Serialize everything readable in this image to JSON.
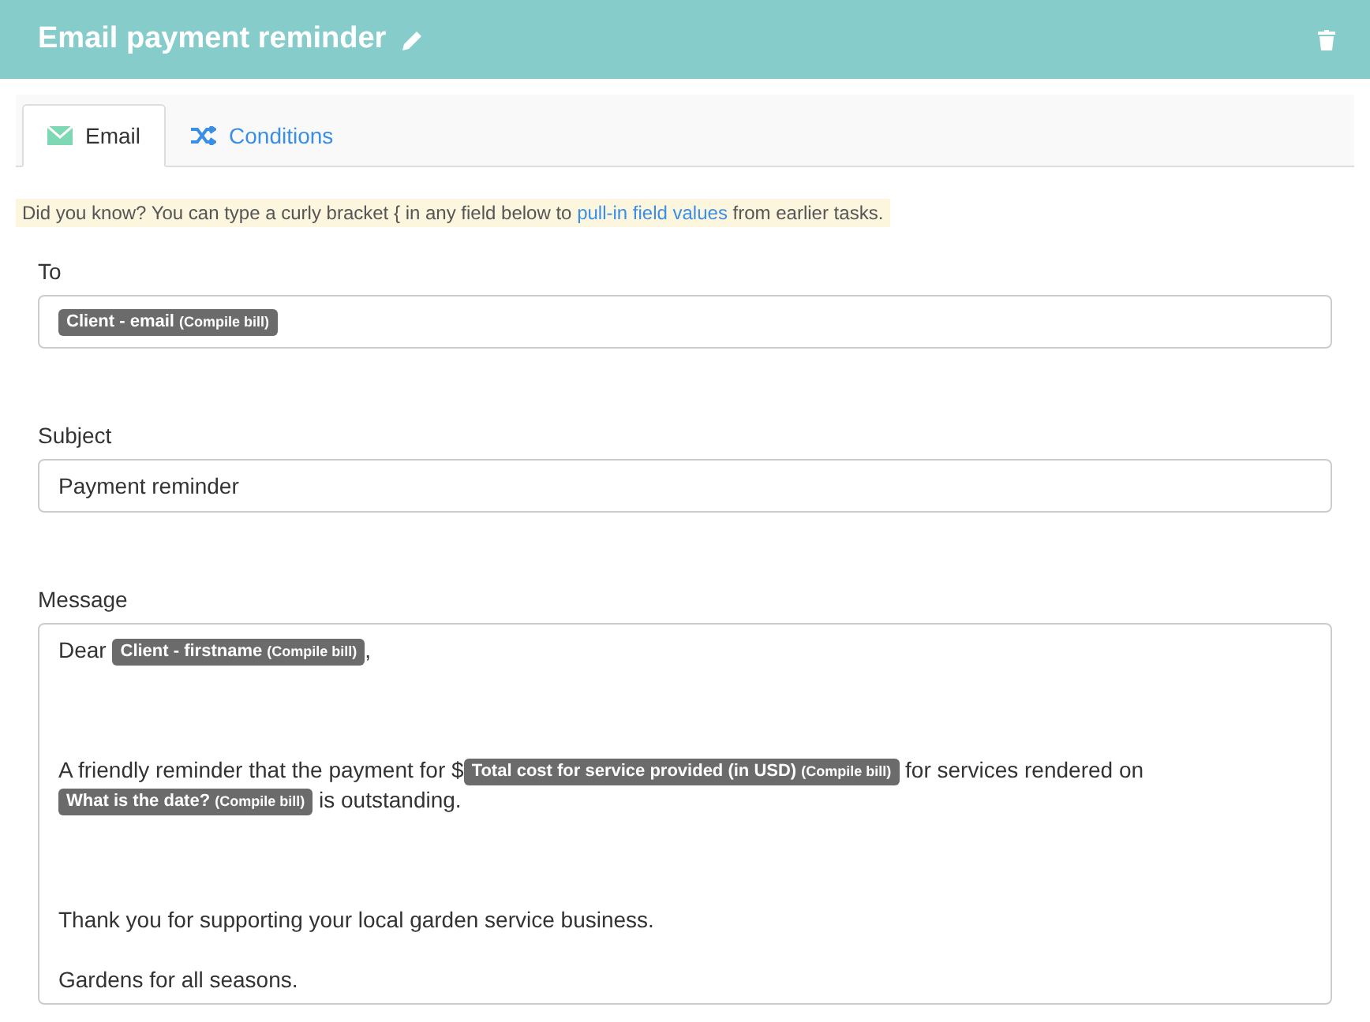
{
  "header": {
    "title": "Email payment reminder"
  },
  "tabs": [
    {
      "label": "Email",
      "selected": true,
      "kind": "email"
    },
    {
      "label": "Conditions",
      "selected": false,
      "kind": "conditions"
    }
  ],
  "tip": {
    "before": "Did you know? You can type a curly bracket { in any field below to",
    "link": "pull-in field values",
    "after": "from earlier tasks."
  },
  "fields": [
    {
      "label": "To",
      "kind": "tokens",
      "tokens": [
        {
          "label": "Client - email",
          "source": "(Compile bill)"
        }
      ]
    },
    {
      "label": "Subject",
      "kind": "text",
      "value": "Payment reminder"
    }
  ],
  "message": {
    "label": "Message",
    "paragraphs": [
      [
        {
          "kind": "text",
          "text": "Dear"
        },
        {
          "kind": "token",
          "label": "Client - firstname",
          "source": "(Compile bill)"
        },
        {
          "kind": "text",
          "text": ","
        }
      ],
      [
        {
          "kind": "text",
          "text": "A friendly reminder that the payment for $"
        },
        {
          "kind": "token",
          "label": "Total cost for service provided (in USD)",
          "source": "(Compile bill)"
        },
        {
          "kind": "text",
          "text": "for services rendered on"
        },
        {
          "kind": "token",
          "label": "What is the date?",
          "source": "(Compile bill)"
        },
        {
          "kind": "text",
          "text": "is outstanding."
        }
      ],
      [
        {
          "kind": "text",
          "text": "Thank you for supporting your local garden service business."
        }
      ],
      [
        {
          "kind": "text",
          "text": "Gardens for all seasons."
        }
      ]
    ]
  }
}
